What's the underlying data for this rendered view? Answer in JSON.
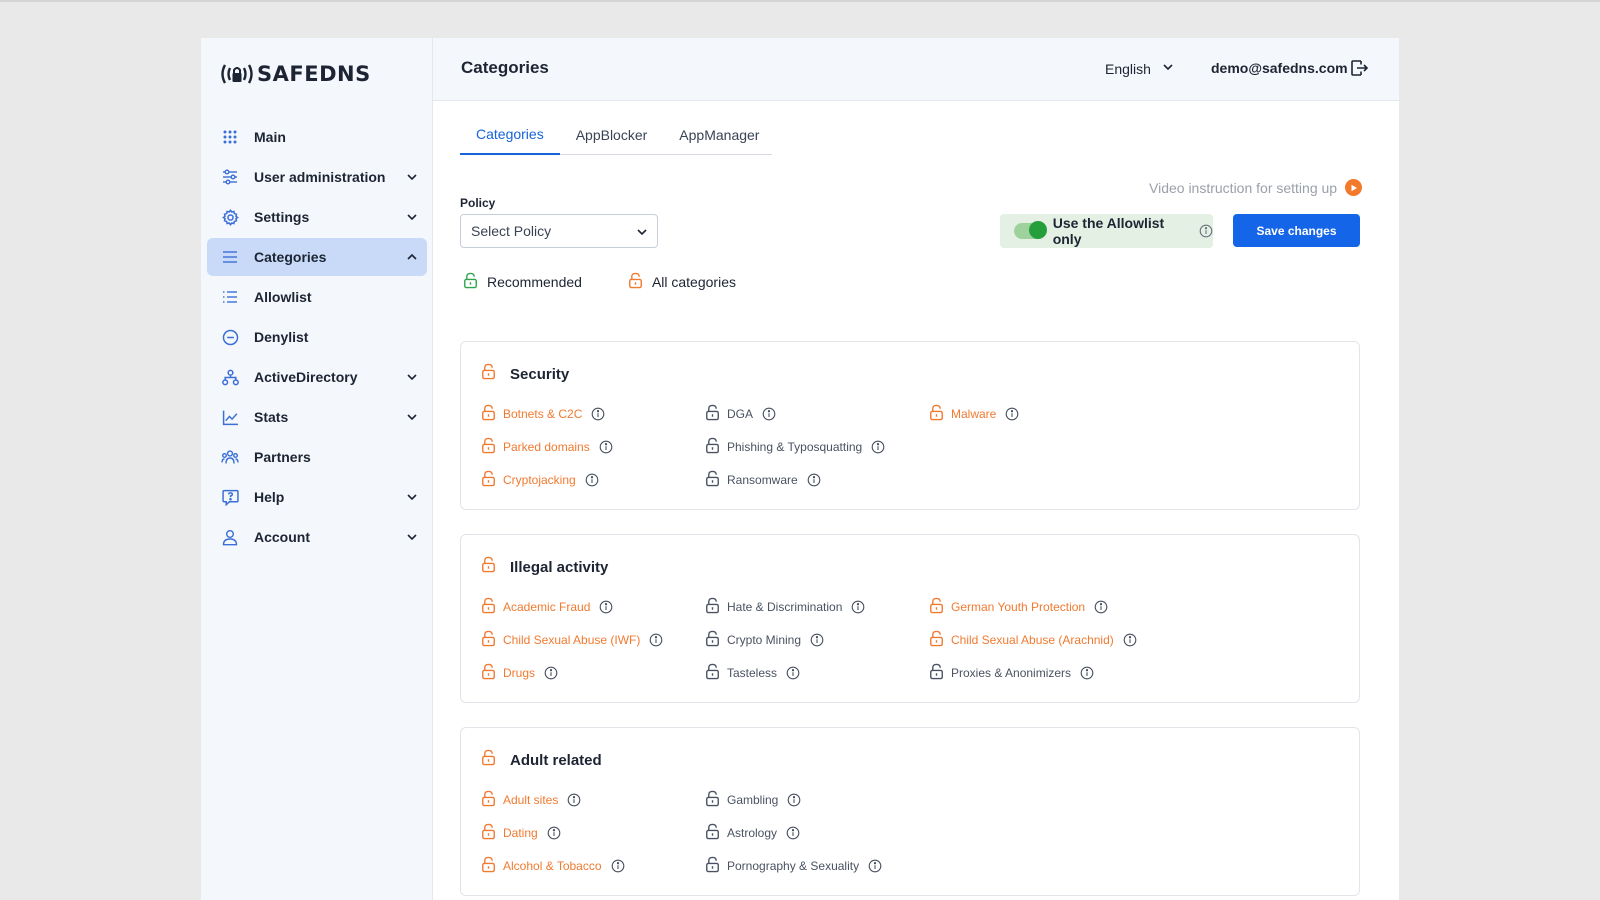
{
  "brand": {
    "logo_text": "SAFEDNS"
  },
  "sidebar": {
    "items": [
      {
        "label": "Main",
        "icon": "grid-icon",
        "chevron": "",
        "active": false
      },
      {
        "label": "User administration",
        "icon": "sliders-icon",
        "chevron": "down",
        "active": false
      },
      {
        "label": "Settings",
        "icon": "gear-icon",
        "chevron": "down",
        "active": false
      },
      {
        "label": "Categories",
        "icon": "menu-icon",
        "chevron": "up",
        "active": true
      },
      {
        "label": "Allowlist",
        "icon": "list-icon",
        "chevron": "",
        "active": false
      },
      {
        "label": "Denylist",
        "icon": "minus-circle-icon",
        "chevron": "",
        "active": false
      },
      {
        "label": "ActiveDirectory",
        "icon": "network-icon",
        "chevron": "down",
        "active": false
      },
      {
        "label": "Stats",
        "icon": "chart-icon",
        "chevron": "down",
        "active": false
      },
      {
        "label": "Partners",
        "icon": "users-icon",
        "chevron": "",
        "active": false
      },
      {
        "label": "Help",
        "icon": "help-icon",
        "chevron": "down",
        "active": false
      },
      {
        "label": "Account",
        "icon": "user-icon",
        "chevron": "down",
        "active": false
      }
    ]
  },
  "header": {
    "title": "Categories",
    "language": "English",
    "email": "demo@safedns.com"
  },
  "tabs": [
    {
      "label": "Categories",
      "active": true
    },
    {
      "label": "AppBlocker",
      "active": false
    },
    {
      "label": "AppManager",
      "active": false
    }
  ],
  "toolbar": {
    "video_link": "Video instruction for setting up",
    "policy_label": "Policy",
    "policy_placeholder": "Select Policy",
    "allowlist_label": "Use the Allowlist only",
    "allowlist_enabled": true,
    "save_label": "Save changes"
  },
  "legend": {
    "recommended": "Recommended",
    "all": "All categories"
  },
  "colors": {
    "accent": "#1565e8",
    "blocked": "#f07a30",
    "recommended": "#2ea44f",
    "allowed": "#4a5261",
    "active_nav": "#c8daf8"
  },
  "sections": [
    {
      "title": "Security",
      "items": [
        {
          "label": "Botnets & C2C",
          "blocked": true
        },
        {
          "label": "Parked domains",
          "blocked": true
        },
        {
          "label": "Cryptojacking",
          "blocked": true
        },
        {
          "label": "DGA",
          "blocked": false
        },
        {
          "label": "Phishing & Typosquatting",
          "blocked": false
        },
        {
          "label": "Ransomware",
          "blocked": false
        },
        {
          "label": "Malware",
          "blocked": true
        }
      ]
    },
    {
      "title": "Illegal activity",
      "items": [
        {
          "label": "Academic Fraud",
          "blocked": true
        },
        {
          "label": "Child Sexual Abuse (IWF)",
          "blocked": true
        },
        {
          "label": "Drugs",
          "blocked": true
        },
        {
          "label": "Hate & Discrimination",
          "blocked": false
        },
        {
          "label": "Crypto Mining",
          "blocked": false
        },
        {
          "label": "Tasteless",
          "blocked": false
        },
        {
          "label": "German Youth Protection",
          "blocked": true
        },
        {
          "label": "Child Sexual Abuse (Arachnid)",
          "blocked": true
        },
        {
          "label": "Proxies & Anonimizers",
          "blocked": false
        }
      ]
    },
    {
      "title": "Adult related",
      "items": [
        {
          "label": "Adult sites",
          "blocked": true
        },
        {
          "label": "Dating",
          "blocked": true
        },
        {
          "label": "Alcohol & Tobacco",
          "blocked": true
        },
        {
          "label": "Gambling",
          "blocked": false
        },
        {
          "label": "Astrology",
          "blocked": false
        },
        {
          "label": "Pornography & Sexuality",
          "blocked": false
        }
      ]
    }
  ]
}
